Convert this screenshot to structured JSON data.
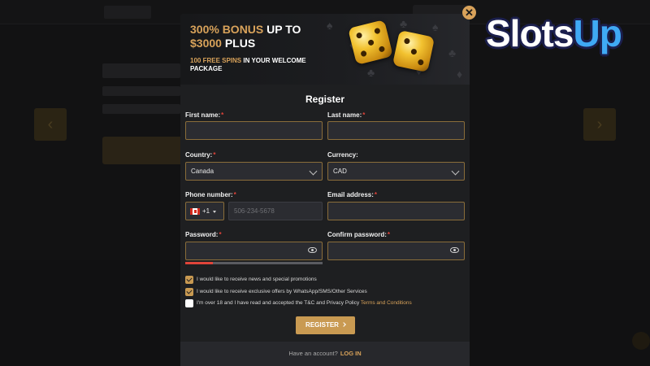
{
  "watermark": {
    "brand_part1": "Slots",
    "brand_part2": "Up"
  },
  "banner": {
    "bonus_highlight": "300% BONUS",
    "bonus_text_1": "UP TO",
    "bonus_amount": "$3000",
    "bonus_text_2": "PLUS",
    "spins_highlight": "100 FREE SPINS",
    "spins_text": "IN YOUR WELCOME PACKAGE"
  },
  "form": {
    "title": "Register",
    "required_mark": "*",
    "first_name": {
      "label": "First name:",
      "value": ""
    },
    "last_name": {
      "label": "Last name:",
      "value": ""
    },
    "country": {
      "label": "Country:",
      "value": "Canada"
    },
    "currency": {
      "label": "Currency:",
      "value": "CAD"
    },
    "phone": {
      "label": "Phone number:",
      "dial_code": "+1",
      "placeholder": "506-234-5678"
    },
    "email": {
      "label": "Email address:",
      "value": ""
    },
    "password": {
      "label": "Password:",
      "value": "",
      "strength_fraction": 0.2
    },
    "confirm_password": {
      "label": "Confirm password:",
      "value": ""
    },
    "checkboxes": [
      {
        "text": "I would like to receive news and special promotions",
        "checked": true
      },
      {
        "text": "I would like to receive exclusive offers by WhatsApp/SMS/Other Services",
        "checked": true
      },
      {
        "text": "I'm over 18 and I have read and accepted the T&C and Privacy Policy",
        "link": "Terms and Conditions",
        "checked": false
      }
    ],
    "submit_label": "REGISTER"
  },
  "footer": {
    "prompt": "Have an account?",
    "login_label": "LOG IN"
  },
  "colors": {
    "accent": "#c99a52",
    "gold_text": "#d8a25a",
    "error": "#e0443a",
    "modal_bg": "#1e1f21"
  },
  "icons": {
    "close": "close-icon",
    "dropdown": "chevron-down-icon",
    "visibility": "eye-icon",
    "flag": "canada-flag-icon"
  }
}
